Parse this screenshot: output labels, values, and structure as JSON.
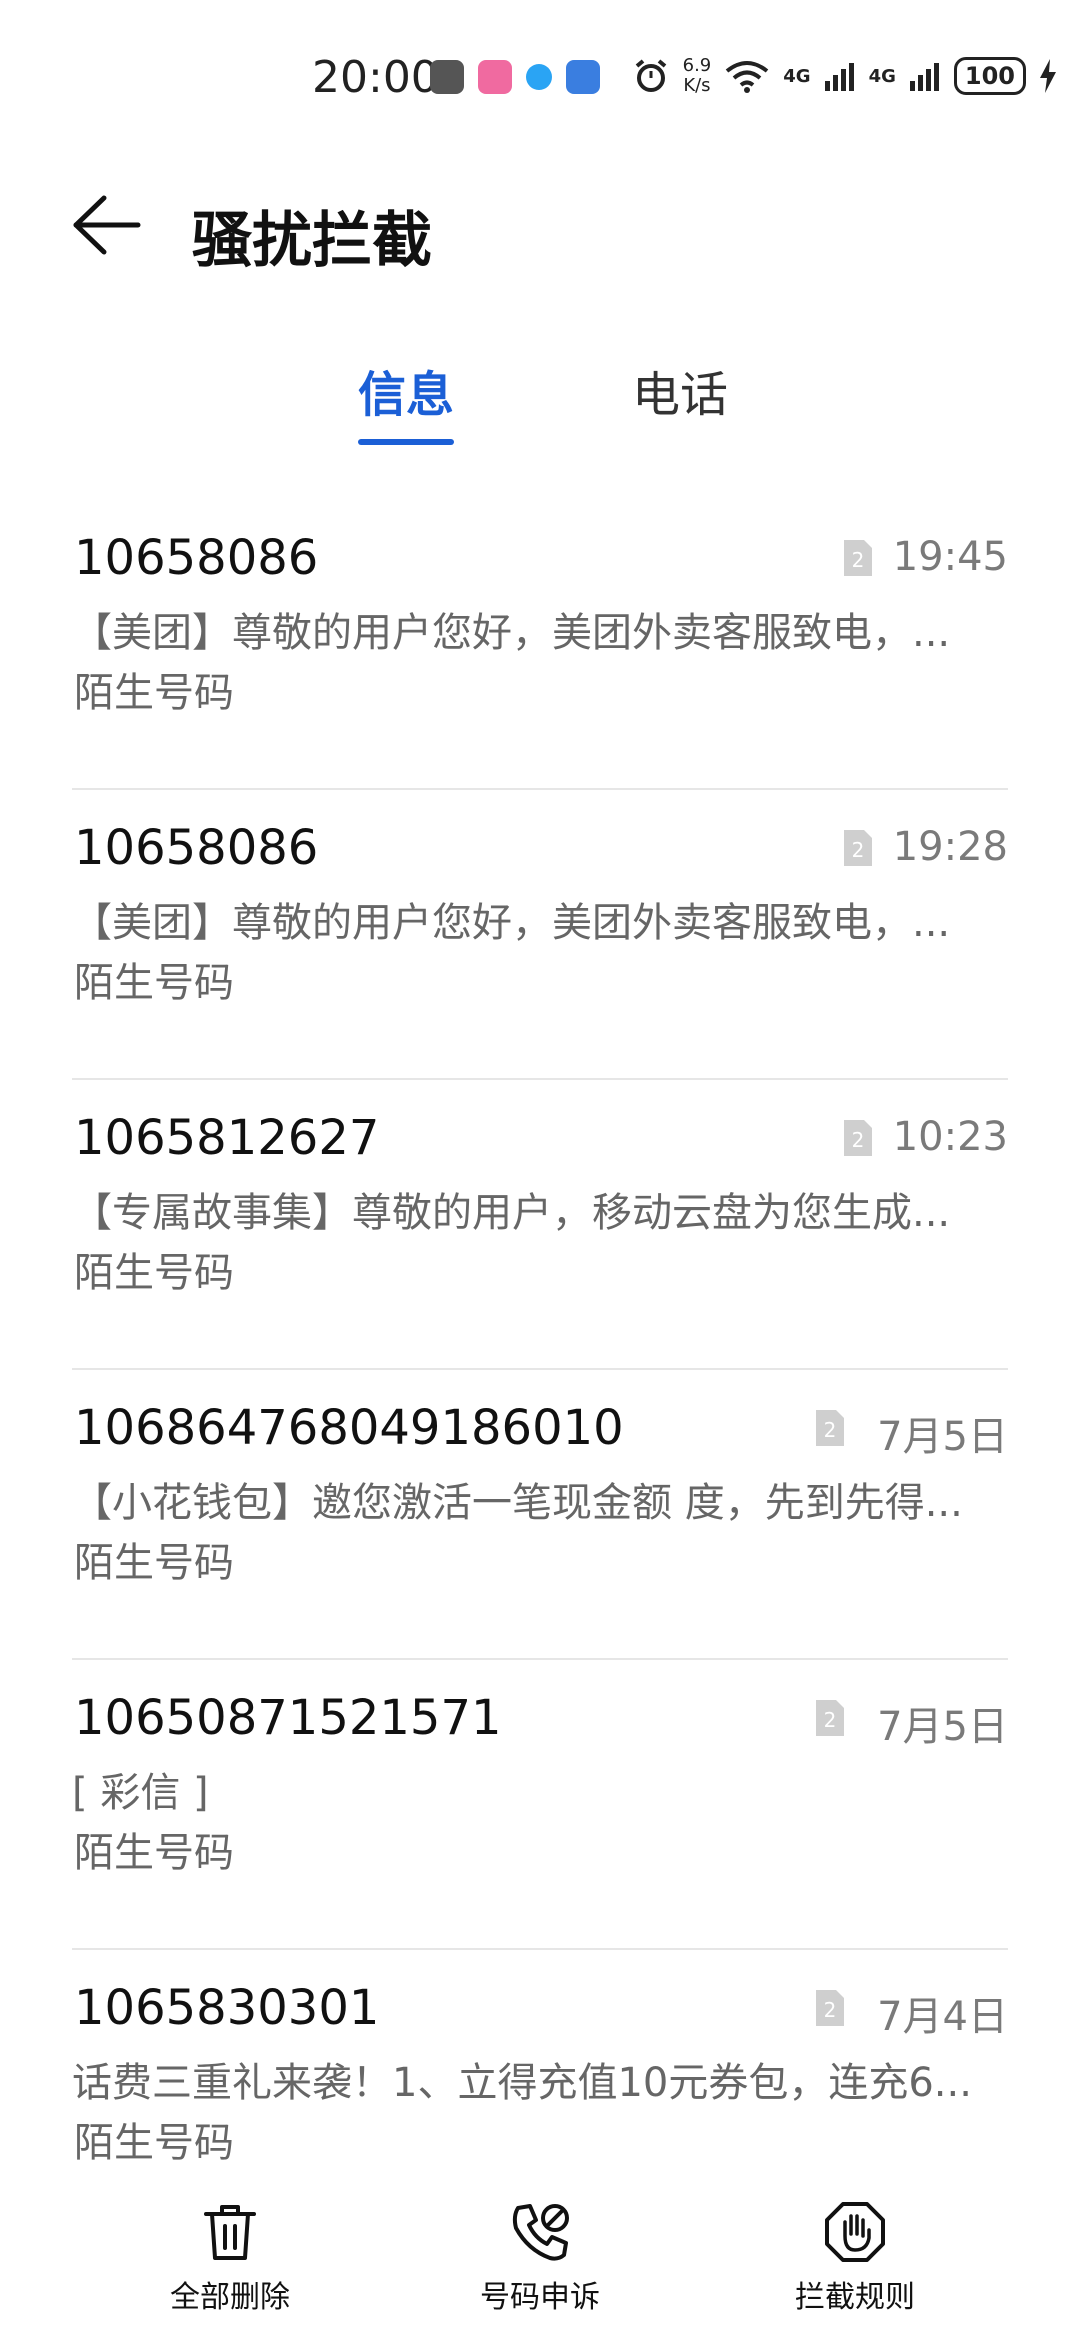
{
  "status_bar": {
    "time": "20:00",
    "net_speed_value": "6.9",
    "net_speed_unit": "K/s",
    "net_type_1": "4G",
    "net_type_2": "4G",
    "battery": "100"
  },
  "header": {
    "title": "骚扰拦截"
  },
  "tabs": [
    {
      "label": "信息",
      "active": true
    },
    {
      "label": "电话",
      "active": false
    }
  ],
  "messages": [
    {
      "sender": "10658086",
      "time": "19:45",
      "preview": "【美团】尊敬的用户您好，美团外卖客服致电，...",
      "tag": "陌生号码"
    },
    {
      "sender": "10658086",
      "time": "19:28",
      "preview": "【美团】尊敬的用户您好，美团外卖客服致电，...",
      "tag": "陌生号码"
    },
    {
      "sender": "1065812627",
      "time": "10:23",
      "preview": "【专属故事集】尊敬的用户，移动云盘为您生成...",
      "tag": "陌生号码"
    },
    {
      "sender": "106864768049186010",
      "time": "7月5日",
      "preview": "【小花钱包】邀您激活一笔现金额 度，先到先得...",
      "tag": "陌生号码"
    },
    {
      "sender": "10650871521571",
      "time": "7月5日",
      "preview": "[ 彩信 ]",
      "tag": "陌生号码"
    },
    {
      "sender": "1065830301",
      "time": "7月4日",
      "preview": "话费三重礼来袭！1、立得充值10元券包，连充6...",
      "tag": "陌生号码"
    }
  ],
  "bottom_bar": {
    "delete_all": "全部删除",
    "appeal": "号码申诉",
    "rules": "拦截规则"
  },
  "colors": {
    "accent": "#1b5fd6",
    "sim_icon": "#cfcfcf"
  }
}
